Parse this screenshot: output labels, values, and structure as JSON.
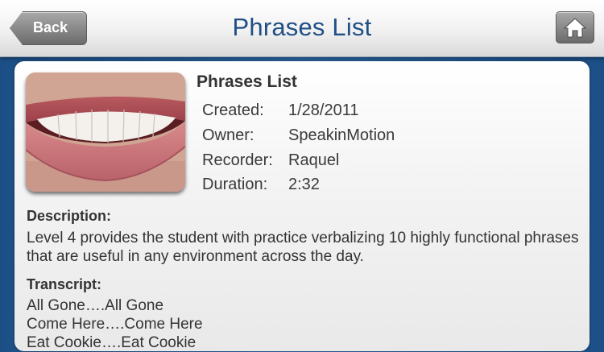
{
  "nav": {
    "title": "Phrases List",
    "back_label": "Back"
  },
  "lesson": {
    "title": "Phrases List",
    "meta": [
      {
        "key": "Created:",
        "value": "1/28/2011"
      },
      {
        "key": "Owner:",
        "value": "SpeakinMotion"
      },
      {
        "key": "Recorder:",
        "value": "Raquel"
      },
      {
        "key": "Duration:",
        "value": "2:32"
      }
    ],
    "description_heading": "Description:",
    "description": "Level 4 provides the student with practice verbalizing 10 highly functional phrases that are useful in any environment across the day.",
    "transcript_heading": "Transcript:",
    "transcript": [
      "All Gone….All Gone",
      "Come Here….Come Here",
      "Eat Cookie….Eat Cookie"
    ]
  },
  "icons": {
    "home": "home-icon",
    "back": "back-arrow"
  },
  "colors": {
    "title_blue": "#1f4f84",
    "background_blue": "#2a68a8"
  }
}
